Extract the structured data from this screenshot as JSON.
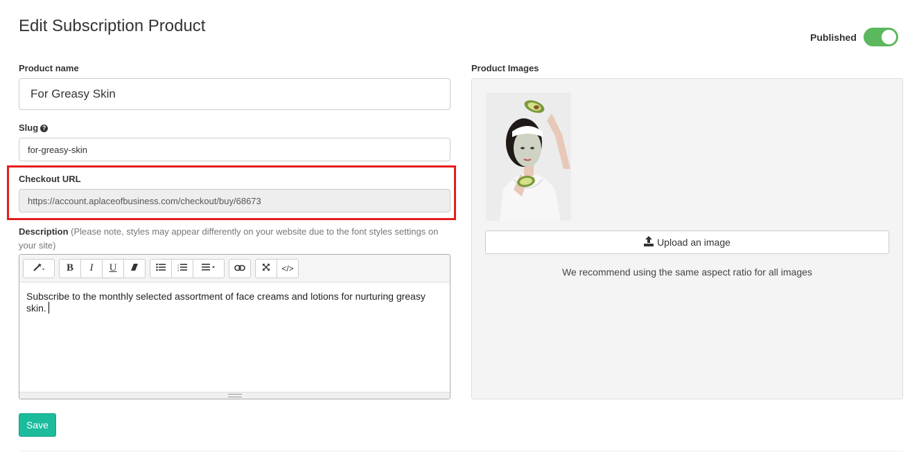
{
  "page": {
    "title": "Edit Subscription Product"
  },
  "status": {
    "label": "Published",
    "enabled": true,
    "toggle_color": "#5cb85c"
  },
  "product_name": {
    "label": "Product name",
    "value": "For Greasy Skin"
  },
  "slug": {
    "label": "Slug",
    "value": "for-greasy-skin",
    "help_icon": "question-circle-icon"
  },
  "checkout_url": {
    "label": "Checkout URL",
    "value": "https://account.aplaceofbusiness.com/checkout/buy/68673",
    "readonly": true,
    "highlight_color": "#e41c1c"
  },
  "description": {
    "label": "Description",
    "hint": "(Please note, styles may appear differently on your website due to the font styles settings on your site)",
    "content": "Subscribe to the monthly selected assortment of face creams and lotions for nurturing greasy skin.",
    "toolbar": {
      "style_icon": "magic-wand-icon",
      "bold": "B",
      "italic": "I",
      "underline": "U",
      "clear_icon": "eraser-icon",
      "ul_icon": "unordered-list-icon",
      "ol_icon": "ordered-list-icon",
      "align_icon": "align-icon",
      "link_icon": "link-icon",
      "fullscreen_icon": "expand-icon",
      "code": "</>"
    }
  },
  "save": {
    "label": "Save",
    "color": "#1abc9c"
  },
  "images": {
    "label": "Product Images",
    "upload_label": "Upload an image",
    "upload_icon": "upload-icon",
    "recommendation": "We recommend using the same aspect ratio for all images"
  }
}
